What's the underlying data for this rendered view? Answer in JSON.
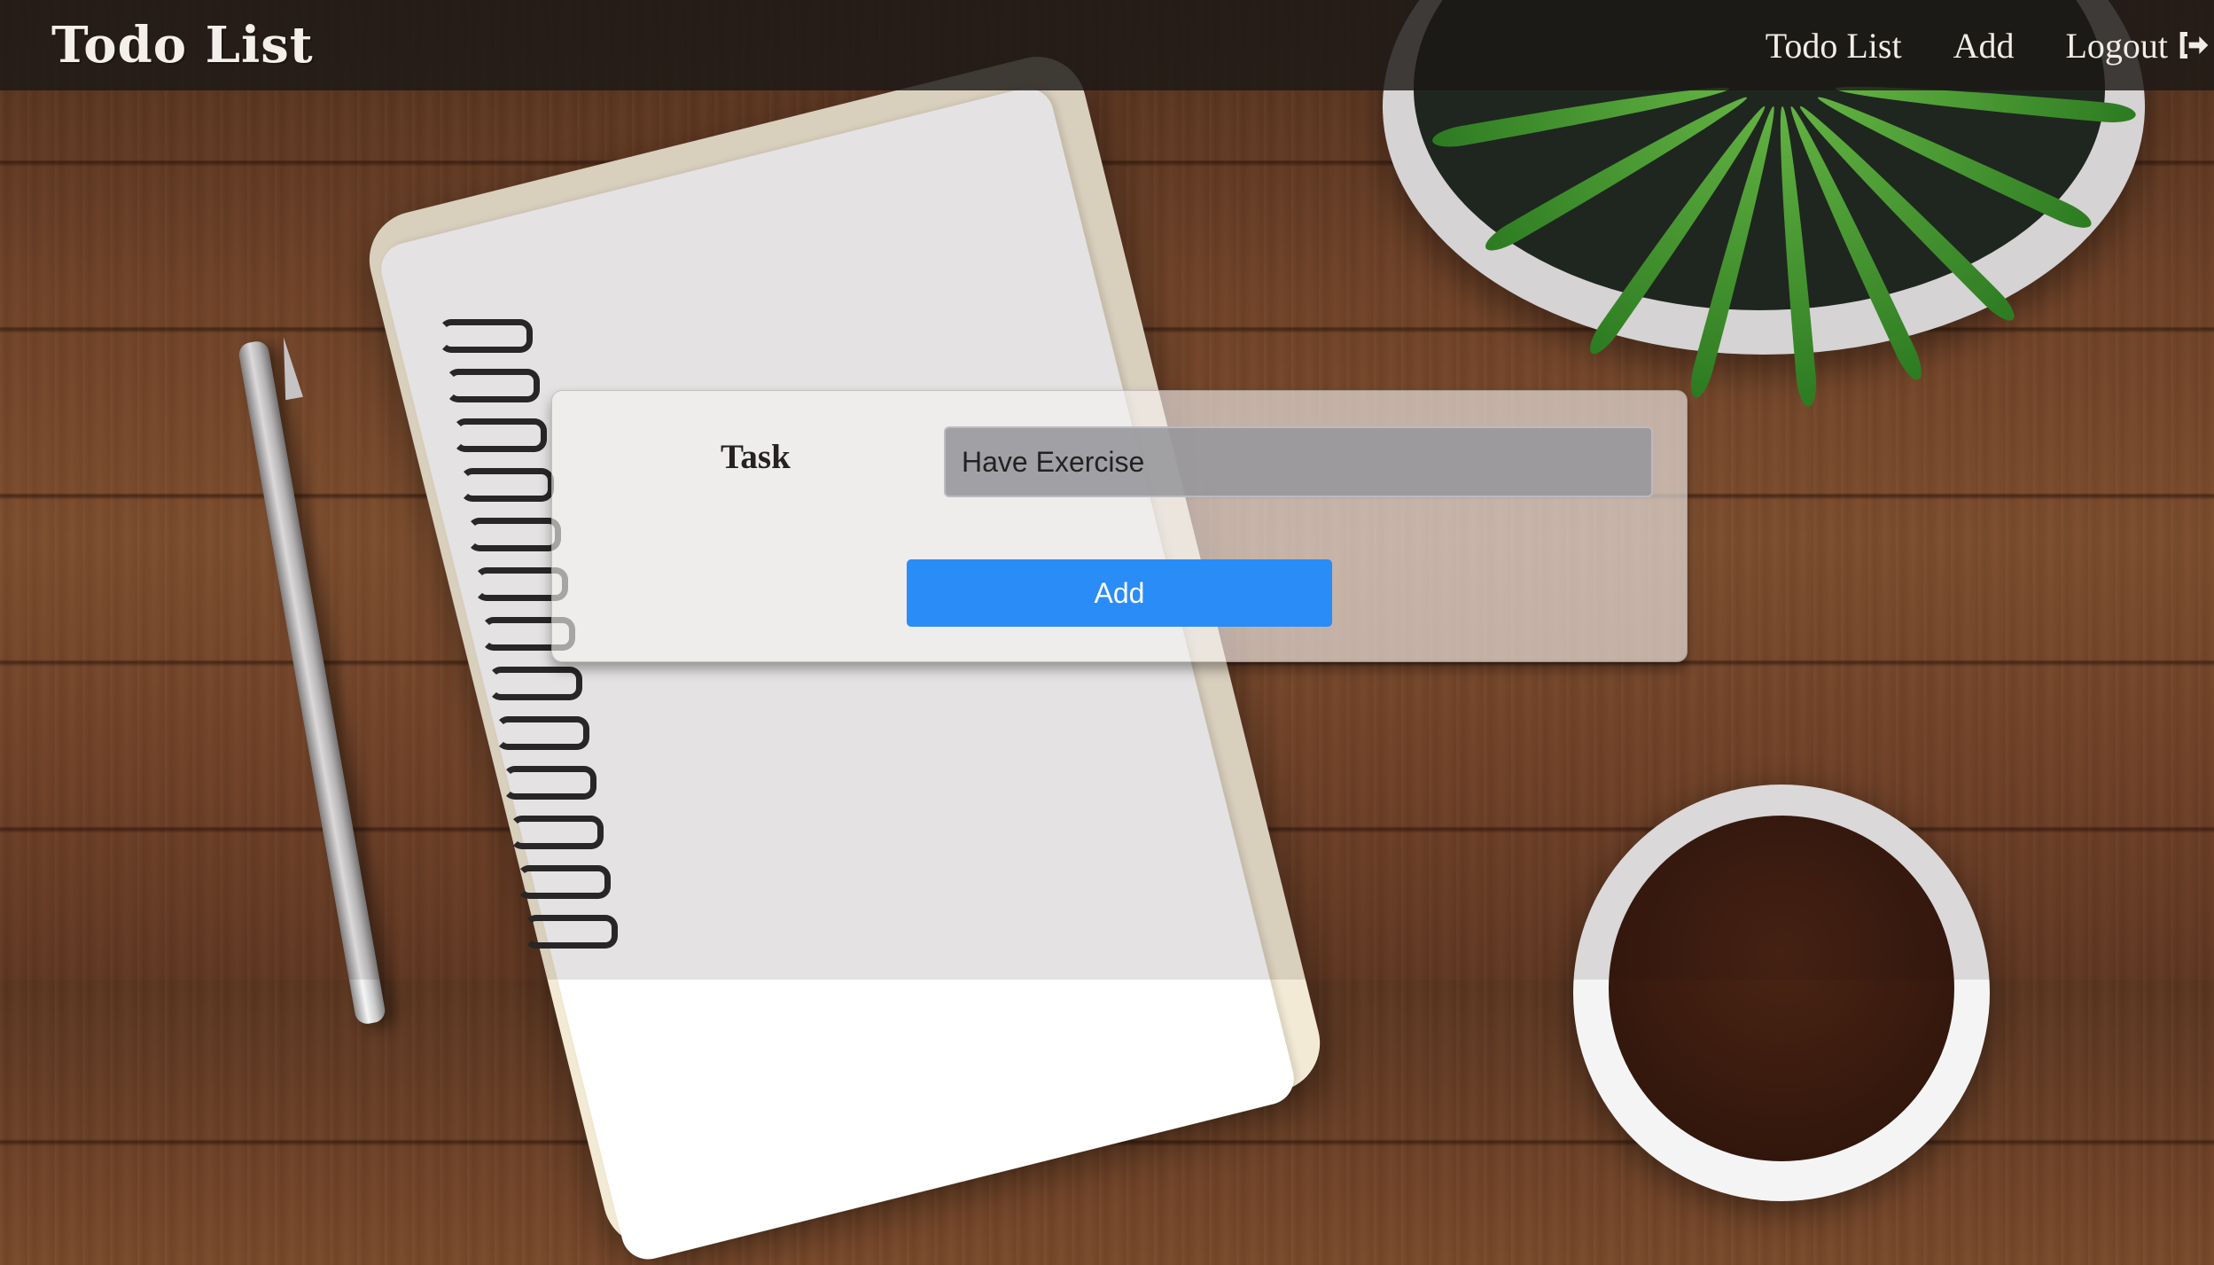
{
  "navbar": {
    "brand": "Todo List",
    "links": [
      {
        "label": "Todo List"
      },
      {
        "label": "Add"
      },
      {
        "label": "Logout",
        "icon": "logout-icon"
      }
    ]
  },
  "form": {
    "task_label": "Task",
    "task_value": "Have Exercise",
    "submit_label": "Add"
  },
  "colors": {
    "navbar_bg": "#1c1816",
    "button_bg": "#2a8cf6",
    "button_text": "#ffffff"
  }
}
